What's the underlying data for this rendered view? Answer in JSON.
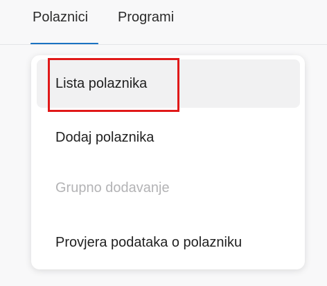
{
  "tabs": {
    "polaznici_label": "Polaznici",
    "programi_label": "Programi",
    "active": "Polaznici"
  },
  "menu": {
    "items": [
      {
        "label": "Lista polaznika",
        "state": "selected"
      },
      {
        "label": "Dodaj polaznika",
        "state": "enabled"
      },
      {
        "label": "Grupno dodavanje",
        "state": "disabled"
      },
      {
        "label": "Provjera podataka o polazniku",
        "state": "enabled"
      }
    ]
  },
  "colors": {
    "accent": "#1a73c2",
    "highlight": "#e01818",
    "selected_bg": "#f1f1f2",
    "disabled_text": "#b3b3b5"
  }
}
